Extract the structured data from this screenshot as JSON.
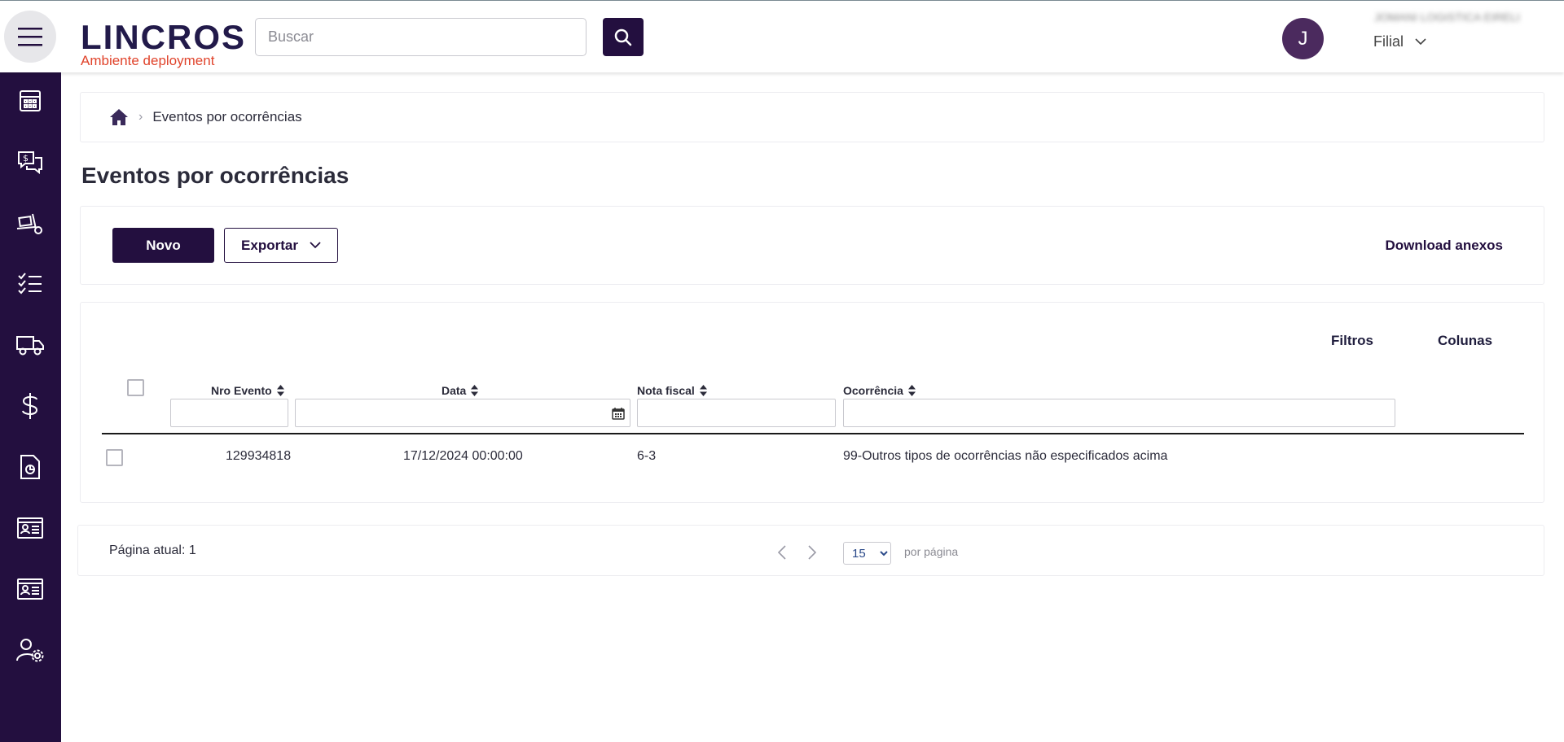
{
  "header": {
    "logo_text": "LINCROS",
    "logo_subtitle": "Ambiente deployment",
    "search_placeholder": "Buscar",
    "avatar_initial": "J",
    "company_name": "JOMANI LOGISTICA EIRELI",
    "branch_label": "Filial"
  },
  "sidebar": {
    "items": [
      {
        "icon": "calculator-icon"
      },
      {
        "icon": "price-chat-icon"
      },
      {
        "icon": "dolly-box-icon"
      },
      {
        "icon": "checklist-icon"
      },
      {
        "icon": "truck-icon"
      },
      {
        "icon": "dollar-icon"
      },
      {
        "icon": "report-chart-icon"
      },
      {
        "icon": "id-card-icon"
      },
      {
        "icon": "id-card-icon"
      },
      {
        "icon": "user-settings-icon"
      }
    ]
  },
  "breadcrumb": {
    "current": "Eventos por ocorrências"
  },
  "page": {
    "title": "Eventos por ocorrências"
  },
  "toolbar": {
    "new_label": "Novo",
    "export_label": "Exportar",
    "download_label": "Download anexos"
  },
  "table": {
    "filters_label": "Filtros",
    "columns_label": "Colunas",
    "headers": [
      "Nro Evento",
      "Data",
      "Nota fiscal",
      "Ocorrência"
    ],
    "rows": [
      [
        "129934818",
        "17/12/2024 00:00:00",
        "6-3",
        "99-Outros tipos de ocorrências não especificados acima"
      ]
    ]
  },
  "pagination": {
    "current_page_label": "Página atual: 1",
    "page_size": "15",
    "per_page_label": "por página"
  },
  "colors": {
    "primary": "#230f3f",
    "accent": "#e0432b",
    "avatar": "#4b2a5e"
  }
}
